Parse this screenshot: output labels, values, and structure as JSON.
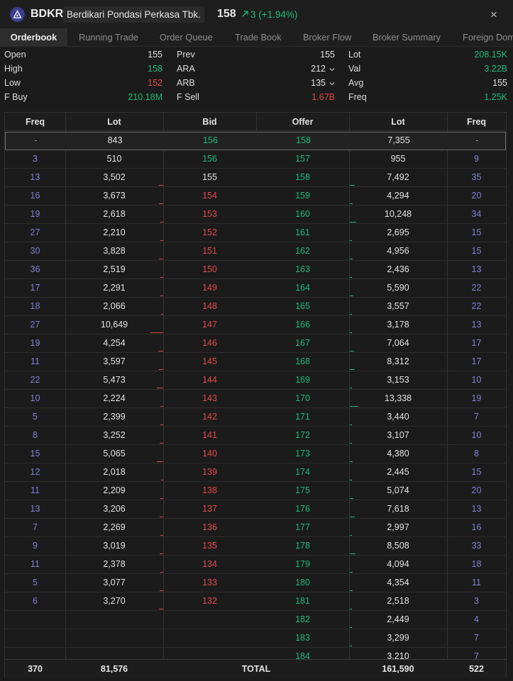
{
  "header": {
    "ticker": "BDKR",
    "company": "Berdikari Pondasi Perkasa Tbk.",
    "price": "158",
    "change": "3 (+1.94%)",
    "close_label": "×"
  },
  "tabs": [
    {
      "label": "Orderbook",
      "active": true
    },
    {
      "label": "Running Trade"
    },
    {
      "label": "Order Queue"
    },
    {
      "label": "Trade Book"
    },
    {
      "label": "Broker Flow"
    },
    {
      "label": "Broker Summary"
    },
    {
      "label": "Foreign Dom"
    }
  ],
  "summary": {
    "col1": [
      {
        "label": "Open",
        "value": "155",
        "color": "#e2e2e2"
      },
      {
        "label": "High",
        "value": "158",
        "color": "#1db87a"
      },
      {
        "label": "Low",
        "value": "152",
        "color": "#e34848"
      },
      {
        "label": "F Buy",
        "value": "210.18M",
        "color": "#1db87a"
      }
    ],
    "col2": [
      {
        "label": "Prev",
        "value": "155",
        "color": "#e2e2e2"
      },
      {
        "label": "ARA",
        "value": "212",
        "color": "#e2e2e2",
        "dropdown": true
      },
      {
        "label": "ARB",
        "value": "135",
        "color": "#e2e2e2",
        "dropdown": true
      },
      {
        "label": "F Sell",
        "value": "1.67B",
        "color": "#e34848"
      }
    ],
    "col3": [
      {
        "label": "Lot",
        "value": "208.15K",
        "color": "#1db87a"
      },
      {
        "label": "Val",
        "value": "3.22B",
        "color": "#1db87a"
      },
      {
        "label": "Avg",
        "value": "155",
        "color": "#e2e2e2"
      },
      {
        "label": "Freq",
        "value": "1.25K",
        "color": "#1db87a"
      }
    ]
  },
  "table": {
    "headers": [
      "Freq",
      "Lot",
      "Bid",
      "Offer",
      "Lot",
      "Freq"
    ],
    "rows": [
      {
        "bf": "-",
        "bl": "843",
        "bid": "156",
        "offer": "158",
        "ol": "7,355",
        "of": "-",
        "bidc": "green",
        "offc": "green",
        "hl": true
      },
      {
        "bf": "3",
        "bl": "510",
        "bid": "156",
        "offer": "157",
        "ol": "955",
        "of": "9",
        "bidc": "green",
        "offc": "green"
      },
      {
        "bf": "13",
        "bl": "3,502",
        "bid": "155",
        "offer": "158",
        "ol": "7,492",
        "of": "35",
        "bidc": "white",
        "offc": "green"
      },
      {
        "bf": "16",
        "bl": "3,673",
        "bid": "154",
        "offer": "159",
        "ol": "4,294",
        "of": "20",
        "bidc": "red",
        "offc": "green"
      },
      {
        "bf": "19",
        "bl": "2,618",
        "bid": "153",
        "offer": "160",
        "ol": "10,248",
        "of": "34",
        "bidc": "red",
        "offc": "green"
      },
      {
        "bf": "27",
        "bl": "2,210",
        "bid": "152",
        "offer": "161",
        "ol": "2,695",
        "of": "15",
        "bidc": "red",
        "offc": "green"
      },
      {
        "bf": "30",
        "bl": "3,828",
        "bid": "151",
        "offer": "162",
        "ol": "4,956",
        "of": "15",
        "bidc": "red",
        "offc": "green"
      },
      {
        "bf": "36",
        "bl": "2,519",
        "bid": "150",
        "offer": "163",
        "ol": "2,436",
        "of": "13",
        "bidc": "red",
        "offc": "green"
      },
      {
        "bf": "17",
        "bl": "2,291",
        "bid": "149",
        "offer": "164",
        "ol": "5,590",
        "of": "22",
        "bidc": "red",
        "offc": "green"
      },
      {
        "bf": "18",
        "bl": "2,066",
        "bid": "148",
        "offer": "165",
        "ol": "3,557",
        "of": "22",
        "bidc": "red",
        "offc": "green"
      },
      {
        "bf": "27",
        "bl": "10,649",
        "bid": "147",
        "offer": "166",
        "ol": "3,178",
        "of": "13",
        "bidc": "red",
        "offc": "green"
      },
      {
        "bf": "19",
        "bl": "4,254",
        "bid": "146",
        "offer": "167",
        "ol": "7,064",
        "of": "17",
        "bidc": "red",
        "offc": "green"
      },
      {
        "bf": "11",
        "bl": "3,597",
        "bid": "145",
        "offer": "168",
        "ol": "8,312",
        "of": "17",
        "bidc": "red",
        "offc": "green"
      },
      {
        "bf": "22",
        "bl": "5,473",
        "bid": "144",
        "offer": "169",
        "ol": "3,153",
        "of": "10",
        "bidc": "red",
        "offc": "green"
      },
      {
        "bf": "10",
        "bl": "2,224",
        "bid": "143",
        "offer": "170",
        "ol": "13,338",
        "of": "19",
        "bidc": "red",
        "offc": "green"
      },
      {
        "bf": "5",
        "bl": "2,399",
        "bid": "142",
        "offer": "171",
        "ol": "3,440",
        "of": "7",
        "bidc": "red",
        "offc": "green"
      },
      {
        "bf": "8",
        "bl": "3,252",
        "bid": "141",
        "offer": "172",
        "ol": "3,107",
        "of": "10",
        "bidc": "red",
        "offc": "green"
      },
      {
        "bf": "15",
        "bl": "5,065",
        "bid": "140",
        "offer": "173",
        "ol": "4,380",
        "of": "8",
        "bidc": "red",
        "offc": "green"
      },
      {
        "bf": "12",
        "bl": "2,018",
        "bid": "139",
        "offer": "174",
        "ol": "2,445",
        "of": "15",
        "bidc": "red",
        "offc": "green"
      },
      {
        "bf": "11",
        "bl": "2,209",
        "bid": "138",
        "offer": "175",
        "ol": "5,074",
        "of": "20",
        "bidc": "red",
        "offc": "green"
      },
      {
        "bf": "13",
        "bl": "3,206",
        "bid": "137",
        "offer": "176",
        "ol": "7,618",
        "of": "13",
        "bidc": "red",
        "offc": "green"
      },
      {
        "bf": "7",
        "bl": "2,269",
        "bid": "136",
        "offer": "177",
        "ol": "2,997",
        "of": "16",
        "bidc": "red",
        "offc": "green"
      },
      {
        "bf": "9",
        "bl": "3,019",
        "bid": "135",
        "offer": "178",
        "ol": "8,508",
        "of": "33",
        "bidc": "red",
        "offc": "green"
      },
      {
        "bf": "11",
        "bl": "2,378",
        "bid": "134",
        "offer": "179",
        "ol": "4,094",
        "of": "18",
        "bidc": "red",
        "offc": "green"
      },
      {
        "bf": "5",
        "bl": "3,077",
        "bid": "133",
        "offer": "180",
        "ol": "4,354",
        "of": "11",
        "bidc": "red",
        "offc": "green"
      },
      {
        "bf": "6",
        "bl": "3,270",
        "bid": "132",
        "offer": "181",
        "ol": "2,518",
        "of": "3",
        "bidc": "red",
        "offc": "green"
      },
      {
        "bf": "",
        "bl": "",
        "bid": "",
        "offer": "182",
        "ol": "2,449",
        "of": "4",
        "bidc": "red",
        "offc": "green"
      },
      {
        "bf": "",
        "bl": "",
        "bid": "",
        "offer": "183",
        "ol": "3,299",
        "of": "7",
        "bidc": "red",
        "offc": "green"
      },
      {
        "bf": "",
        "bl": "",
        "bid": "",
        "offer": "184",
        "ol": "3,210",
        "of": "7",
        "bidc": "red",
        "offc": "green"
      }
    ],
    "footer": {
      "freq_bid": "370",
      "lot_bid": "81,576",
      "label": "TOTAL",
      "lot_offer": "161,590",
      "freq_offer": "522"
    }
  },
  "colors": {
    "green": "#1db87a",
    "red": "#e34848",
    "freq": "#7f7fd6",
    "bg": "#1b1b1b"
  }
}
